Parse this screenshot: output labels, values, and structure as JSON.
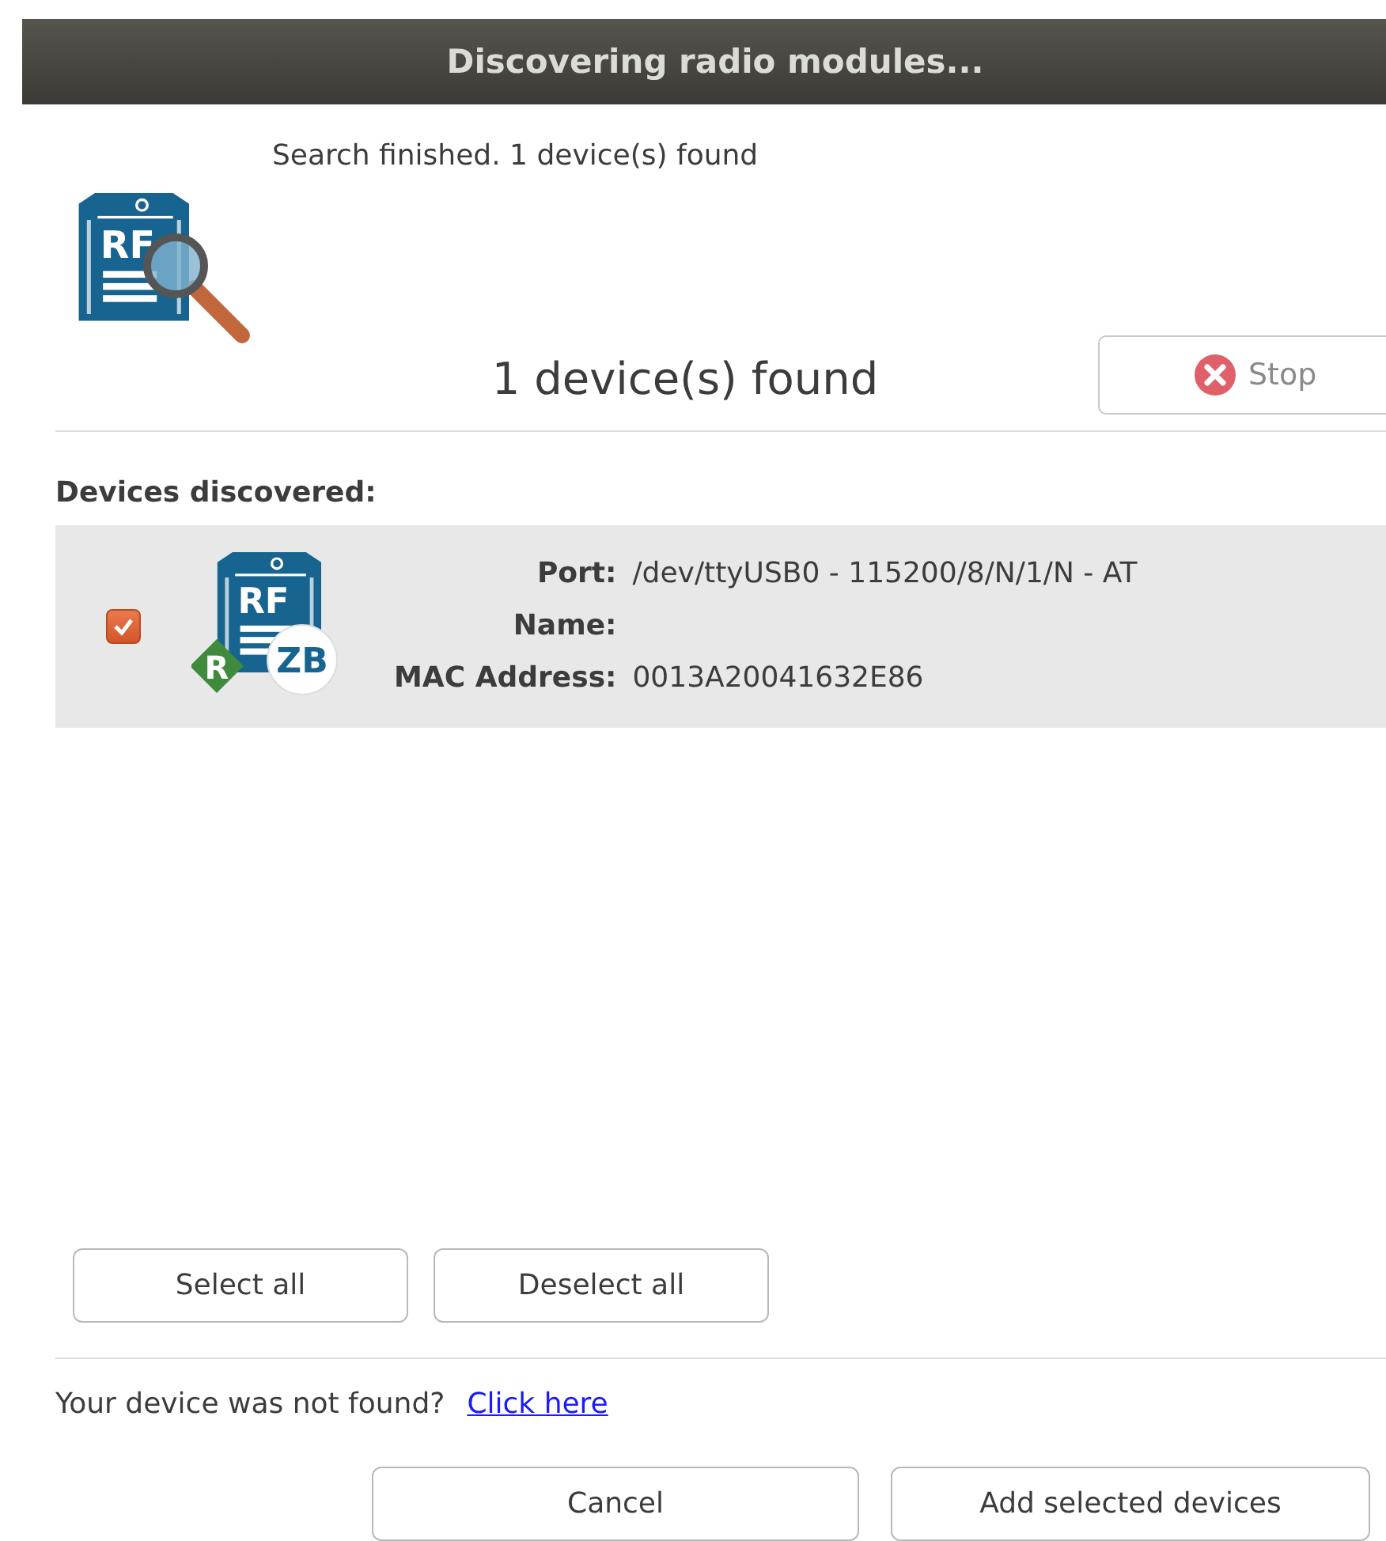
{
  "window": {
    "title": "Discovering radio modules..."
  },
  "search_icon": {
    "module_label": "RF"
  },
  "status": "Search finished. 1 device(s) found",
  "found_count": "1 device(s) found",
  "stop_button": {
    "label": "Stop"
  },
  "devices_heading": "Devices discovered:",
  "devices": [
    {
      "checked": true,
      "module_label": "RF",
      "protocol_badge": "ZB",
      "role_badge": "R",
      "fields": [
        {
          "label": "Port:",
          "value": "/dev/ttyUSB0 - 115200/8/N/1/N - AT"
        },
        {
          "label": "Name:"
        },
        {
          "label": "MAC Address:",
          "value": "0013A20041632E86"
        }
      ]
    }
  ],
  "selection_buttons": [
    "Select all",
    "Deselect all"
  ],
  "help": {
    "text": "Your device was not found?",
    "link": "Click here"
  },
  "buttons": [
    "Cancel",
    "Add selected devices"
  ]
}
